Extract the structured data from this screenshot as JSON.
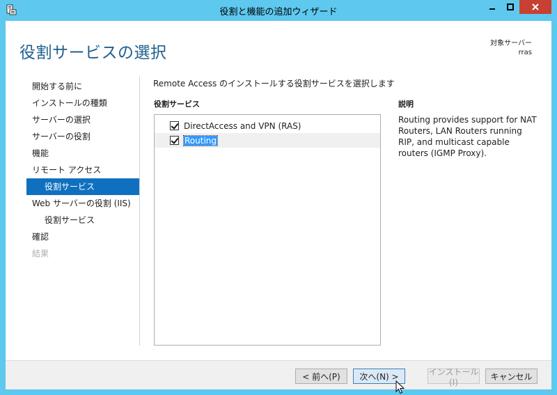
{
  "window": {
    "title": "役割と機能の追加ウィザード"
  },
  "header": {
    "page_title": "役割サービスの選択",
    "server_label": "対象サーバー",
    "server_name": "rras"
  },
  "nav": {
    "items": [
      {
        "label": "開始する前に",
        "state": "normal"
      },
      {
        "label": "インストールの種類",
        "state": "normal"
      },
      {
        "label": "サーバーの選択",
        "state": "normal"
      },
      {
        "label": "サーバーの役割",
        "state": "normal"
      },
      {
        "label": "機能",
        "state": "normal"
      },
      {
        "label": "リモート アクセス",
        "state": "normal"
      },
      {
        "label": "役割サービス",
        "state": "active"
      },
      {
        "label": "Web サーバーの役割 (IIS)",
        "state": "normal"
      },
      {
        "label": "役割サービス",
        "state": "sub"
      },
      {
        "label": "確認",
        "state": "normal"
      },
      {
        "label": "結果",
        "state": "disabled"
      }
    ]
  },
  "content": {
    "instruction": "Remote Access のインストールする役割サービスを選択します",
    "roles_heading": "役割サービス",
    "description_heading": "説明",
    "roles": [
      {
        "label": "DirectAccess and VPN (RAS)",
        "checked": true
      },
      {
        "label": "Routing",
        "checked": true
      }
    ],
    "description": "Routing provides support for NAT Routers, LAN Routers running RIP, and multicast capable routers (IGMP Proxy)."
  },
  "footer": {
    "prev_label": "< 前へ(P)",
    "next_label": "次へ(N) >",
    "install_label": "インストール(I)",
    "cancel_label": "キャンセル"
  },
  "colors": {
    "titlebar": "#5ec8ef",
    "accent": "#1070c0",
    "heading": "#1f5f8f",
    "close": "#c84031"
  }
}
